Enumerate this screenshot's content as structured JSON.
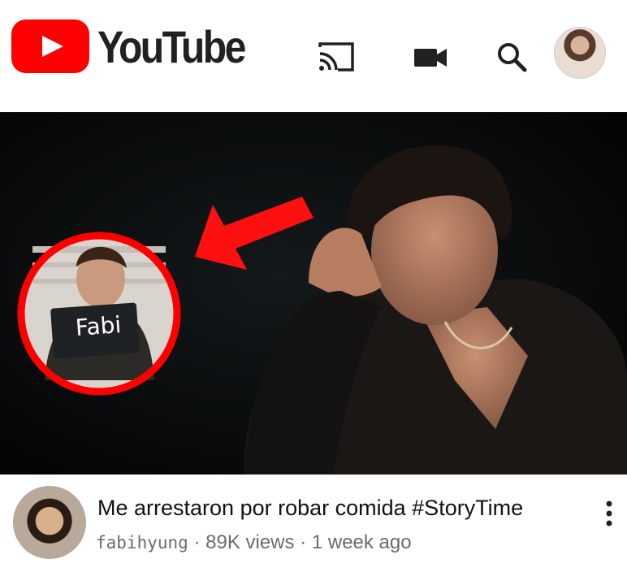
{
  "header": {
    "brand": "YouTube",
    "icons": [
      "cast-icon",
      "camera-icon",
      "search-icon",
      "account-avatar"
    ]
  },
  "thumbnail": {
    "placard_text": "Fabi",
    "accent_color": "#ff0000"
  },
  "video": {
    "title": "Me arrestaron por robar comida #StoryTime",
    "channel": "fabihyung",
    "views": "· 89K views",
    "age": "· 1 week ago",
    "menu_icon": "more-vert-icon"
  }
}
